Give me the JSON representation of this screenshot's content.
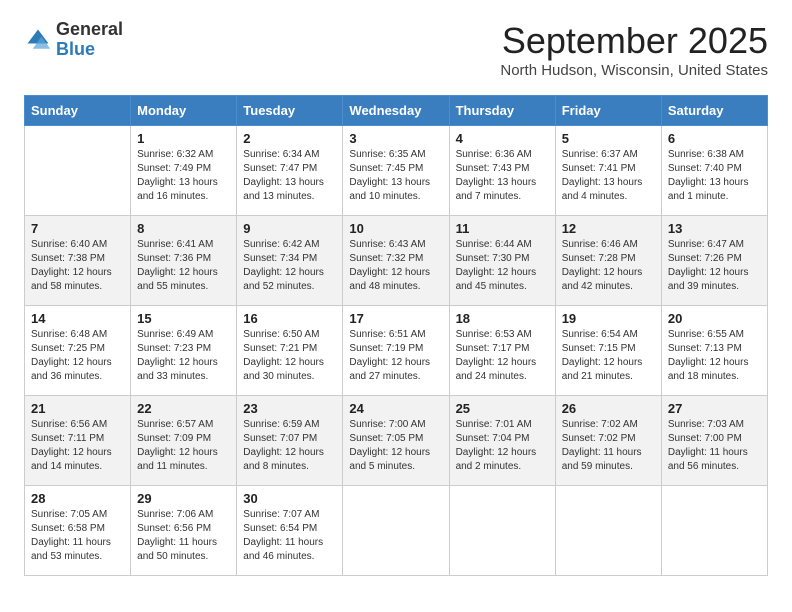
{
  "header": {
    "logo_general": "General",
    "logo_blue": "Blue",
    "month_title": "September 2025",
    "location": "North Hudson, Wisconsin, United States"
  },
  "weekdays": [
    "Sunday",
    "Monday",
    "Tuesday",
    "Wednesday",
    "Thursday",
    "Friday",
    "Saturday"
  ],
  "weeks": [
    [
      {
        "day": "",
        "info": ""
      },
      {
        "day": "1",
        "info": "Sunrise: 6:32 AM\nSunset: 7:49 PM\nDaylight: 13 hours\nand 16 minutes."
      },
      {
        "day": "2",
        "info": "Sunrise: 6:34 AM\nSunset: 7:47 PM\nDaylight: 13 hours\nand 13 minutes."
      },
      {
        "day": "3",
        "info": "Sunrise: 6:35 AM\nSunset: 7:45 PM\nDaylight: 13 hours\nand 10 minutes."
      },
      {
        "day": "4",
        "info": "Sunrise: 6:36 AM\nSunset: 7:43 PM\nDaylight: 13 hours\nand 7 minutes."
      },
      {
        "day": "5",
        "info": "Sunrise: 6:37 AM\nSunset: 7:41 PM\nDaylight: 13 hours\nand 4 minutes."
      },
      {
        "day": "6",
        "info": "Sunrise: 6:38 AM\nSunset: 7:40 PM\nDaylight: 13 hours\nand 1 minute."
      }
    ],
    [
      {
        "day": "7",
        "info": "Sunrise: 6:40 AM\nSunset: 7:38 PM\nDaylight: 12 hours\nand 58 minutes."
      },
      {
        "day": "8",
        "info": "Sunrise: 6:41 AM\nSunset: 7:36 PM\nDaylight: 12 hours\nand 55 minutes."
      },
      {
        "day": "9",
        "info": "Sunrise: 6:42 AM\nSunset: 7:34 PM\nDaylight: 12 hours\nand 52 minutes."
      },
      {
        "day": "10",
        "info": "Sunrise: 6:43 AM\nSunset: 7:32 PM\nDaylight: 12 hours\nand 48 minutes."
      },
      {
        "day": "11",
        "info": "Sunrise: 6:44 AM\nSunset: 7:30 PM\nDaylight: 12 hours\nand 45 minutes."
      },
      {
        "day": "12",
        "info": "Sunrise: 6:46 AM\nSunset: 7:28 PM\nDaylight: 12 hours\nand 42 minutes."
      },
      {
        "day": "13",
        "info": "Sunrise: 6:47 AM\nSunset: 7:26 PM\nDaylight: 12 hours\nand 39 minutes."
      }
    ],
    [
      {
        "day": "14",
        "info": "Sunrise: 6:48 AM\nSunset: 7:25 PM\nDaylight: 12 hours\nand 36 minutes."
      },
      {
        "day": "15",
        "info": "Sunrise: 6:49 AM\nSunset: 7:23 PM\nDaylight: 12 hours\nand 33 minutes."
      },
      {
        "day": "16",
        "info": "Sunrise: 6:50 AM\nSunset: 7:21 PM\nDaylight: 12 hours\nand 30 minutes."
      },
      {
        "day": "17",
        "info": "Sunrise: 6:51 AM\nSunset: 7:19 PM\nDaylight: 12 hours\nand 27 minutes."
      },
      {
        "day": "18",
        "info": "Sunrise: 6:53 AM\nSunset: 7:17 PM\nDaylight: 12 hours\nand 24 minutes."
      },
      {
        "day": "19",
        "info": "Sunrise: 6:54 AM\nSunset: 7:15 PM\nDaylight: 12 hours\nand 21 minutes."
      },
      {
        "day": "20",
        "info": "Sunrise: 6:55 AM\nSunset: 7:13 PM\nDaylight: 12 hours\nand 18 minutes."
      }
    ],
    [
      {
        "day": "21",
        "info": "Sunrise: 6:56 AM\nSunset: 7:11 PM\nDaylight: 12 hours\nand 14 minutes."
      },
      {
        "day": "22",
        "info": "Sunrise: 6:57 AM\nSunset: 7:09 PM\nDaylight: 12 hours\nand 11 minutes."
      },
      {
        "day": "23",
        "info": "Sunrise: 6:59 AM\nSunset: 7:07 PM\nDaylight: 12 hours\nand 8 minutes."
      },
      {
        "day": "24",
        "info": "Sunrise: 7:00 AM\nSunset: 7:05 PM\nDaylight: 12 hours\nand 5 minutes."
      },
      {
        "day": "25",
        "info": "Sunrise: 7:01 AM\nSunset: 7:04 PM\nDaylight: 12 hours\nand 2 minutes."
      },
      {
        "day": "26",
        "info": "Sunrise: 7:02 AM\nSunset: 7:02 PM\nDaylight: 11 hours\nand 59 minutes."
      },
      {
        "day": "27",
        "info": "Sunrise: 7:03 AM\nSunset: 7:00 PM\nDaylight: 11 hours\nand 56 minutes."
      }
    ],
    [
      {
        "day": "28",
        "info": "Sunrise: 7:05 AM\nSunset: 6:58 PM\nDaylight: 11 hours\nand 53 minutes."
      },
      {
        "day": "29",
        "info": "Sunrise: 7:06 AM\nSunset: 6:56 PM\nDaylight: 11 hours\nand 50 minutes."
      },
      {
        "day": "30",
        "info": "Sunrise: 7:07 AM\nSunset: 6:54 PM\nDaylight: 11 hours\nand 46 minutes."
      },
      {
        "day": "",
        "info": ""
      },
      {
        "day": "",
        "info": ""
      },
      {
        "day": "",
        "info": ""
      },
      {
        "day": "",
        "info": ""
      }
    ]
  ]
}
